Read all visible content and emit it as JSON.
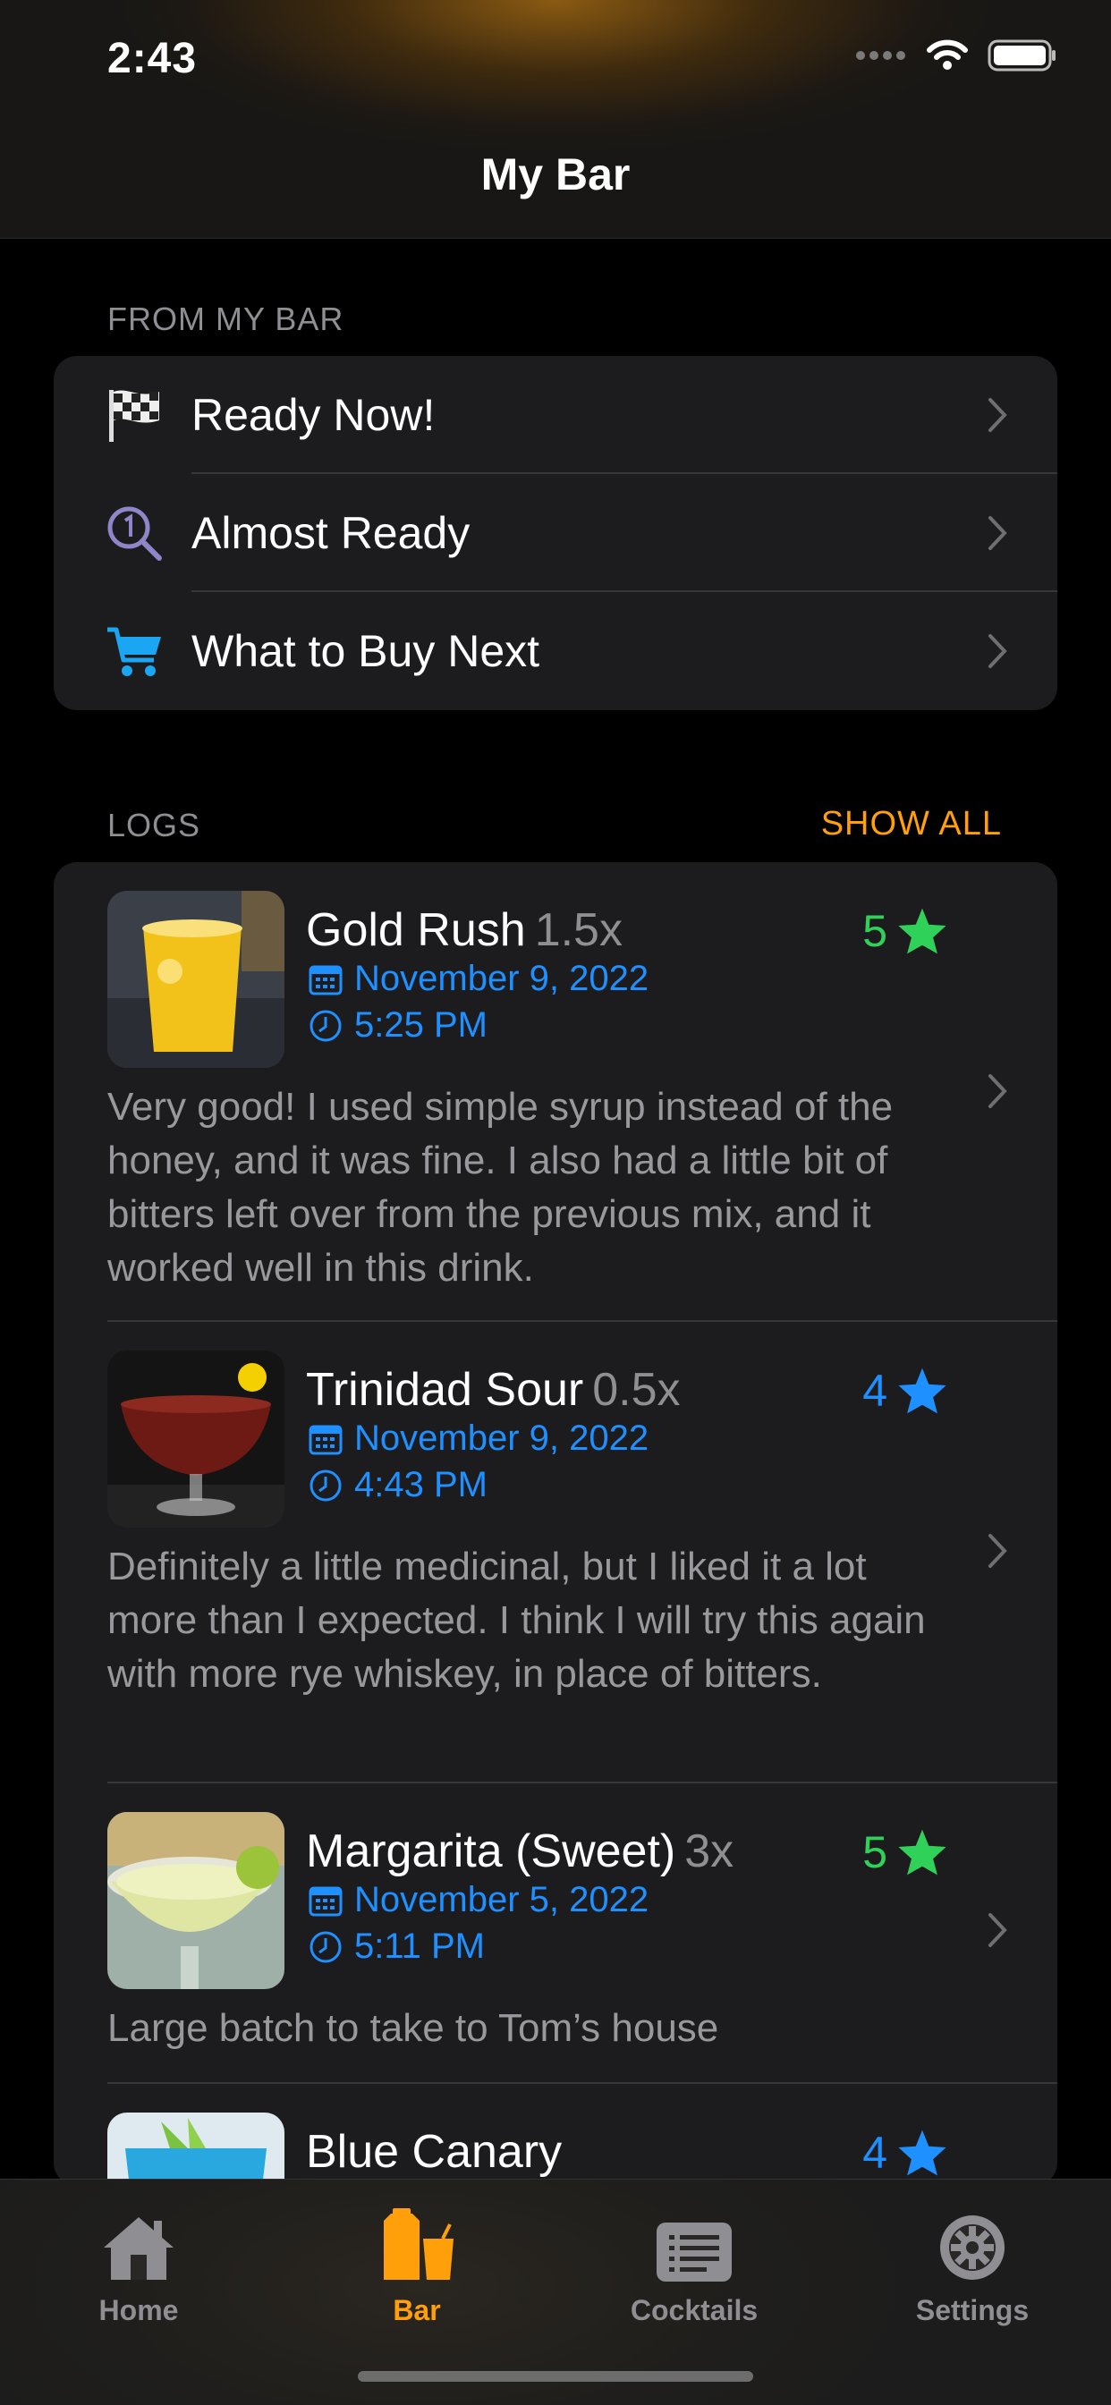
{
  "status_bar": {
    "time": "2:43"
  },
  "nav": {
    "title": "My Bar"
  },
  "from_my_bar": {
    "header": "FROM MY BAR",
    "items": [
      {
        "label": "Ready Now!",
        "icon": "checkered-flag-icon"
      },
      {
        "label": "Almost Ready",
        "icon": "magnifier-one-icon"
      },
      {
        "label": "What to Buy Next",
        "icon": "cart-icon"
      }
    ]
  },
  "logs": {
    "header": "LOGS",
    "show_all": "SHOW ALL",
    "items": [
      {
        "name": "Gold Rush",
        "qty": "1.5x",
        "date": "November 9, 2022",
        "time": "5:25 PM",
        "rating": "5",
        "rating_color": "#30d158",
        "note": "Very good! I used simple syrup instead of the honey, and it was fine. I also had a little bit of bitters left over from the previous mix, and it worked well in this drink."
      },
      {
        "name": "Trinidad Sour",
        "qty": "0.5x",
        "date": "November 9, 2022",
        "time": "4:43 PM",
        "rating": "4",
        "rating_color": "#1e90ff",
        "note": "Definitely a little medicinal, but I liked it a lot more than I expected. I think I will try this again with more rye whiskey, in place of bitters."
      },
      {
        "name": "Margarita (Sweet)",
        "qty": "3x",
        "date": "November 5, 2022",
        "time": "5:11 PM",
        "rating": "5",
        "rating_color": "#30d158",
        "note": "Large batch to take to Tom’s house"
      },
      {
        "name": "Blue Canary",
        "qty": "",
        "rating": "4",
        "rating_color": "#1e90ff"
      }
    ]
  },
  "tabs": [
    {
      "label": "Home",
      "icon": "house-icon",
      "active": false
    },
    {
      "label": "Bar",
      "icon": "bar-icon",
      "active": true
    },
    {
      "label": "Cocktails",
      "icon": "list-icon",
      "active": false
    },
    {
      "label": "Settings",
      "icon": "gear-icon",
      "active": false
    }
  ],
  "colors": {
    "accent": "#ff9f0a",
    "link": "#1e90ff",
    "good": "#30d158",
    "card": "#1c1c1e"
  }
}
